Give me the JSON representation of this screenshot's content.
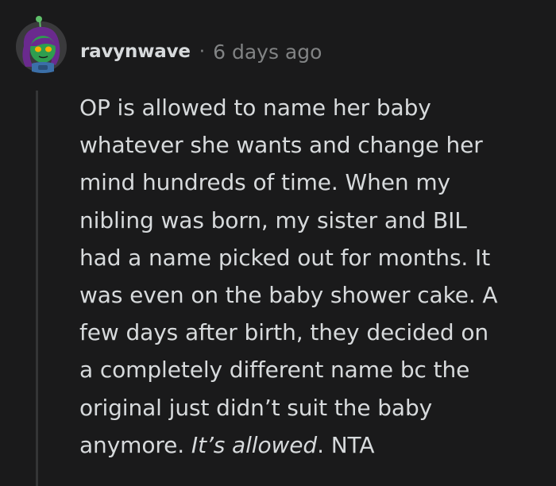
{
  "comment": {
    "username": "ravynwave",
    "separator": "·",
    "timestamp": "6 days ago",
    "body_lines": [
      "OP is allowed to name her baby",
      "whatever she wants and change her",
      "mind hundreds of time. When my",
      "nibling was born, my sister and BIL",
      "had a name picked out for months. It",
      "was even on the baby shower cake. A",
      "few days after birth, they decided on",
      "a completely different name bc the",
      "original just didn’t suit the baby"
    ],
    "last_line": {
      "before": "anymore. ",
      "emphasis": "It’s allowed",
      "after": ". NTA"
    }
  },
  "colors": {
    "background": "#1a1a1b",
    "text": "#d7dadc",
    "muted": "#818384",
    "thread_line": "#343536",
    "avatar_skin": "#2e9e4f",
    "avatar_hair": "#6a2a8e",
    "avatar_eyes": "#ffb000"
  },
  "icons": {
    "avatar": "snoo-avatar-icon"
  }
}
